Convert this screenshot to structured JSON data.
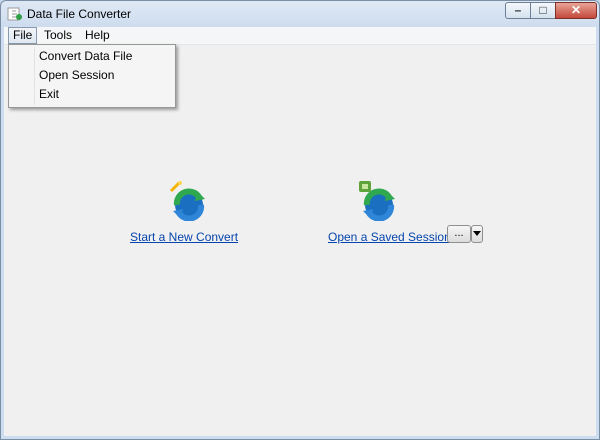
{
  "window": {
    "title": "Data File Converter"
  },
  "menu": {
    "file": "File",
    "tools": "Tools",
    "help": "Help"
  },
  "file_menu": {
    "items": [
      "Convert Data File",
      "Open Session",
      "Exit"
    ]
  },
  "actions": {
    "new_convert": "Start a New Convert",
    "open_session": "Open a Saved Session",
    "browse": "..."
  },
  "controls": {
    "minimize": "–",
    "maximize": "□",
    "close": "✕"
  }
}
